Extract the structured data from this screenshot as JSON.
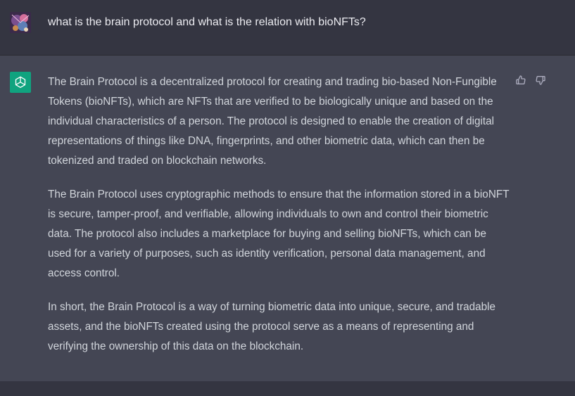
{
  "user_message": {
    "text": "what is the brain protocol and what is the relation with bioNFTs?",
    "avatar": "user-avatar-image"
  },
  "assistant_message": {
    "logo": "openai-logo-icon",
    "paragraphs": [
      "The Brain Protocol is a decentralized protocol for creating and trading bio-based Non-Fungible Tokens (bioNFTs), which are NFTs that are verified to be biologically unique and based on the individual characteristics of a person. The protocol is designed to enable the creation of digital representations of things like DNA, fingerprints, and other biometric data, which can then be tokenized and traded on blockchain networks.",
      "The Brain Protocol uses cryptographic methods to ensure that the information stored in a bioNFT is secure, tamper-proof, and verifiable, allowing individuals to own and control their biometric data. The protocol also includes a marketplace for buying and selling bioNFTs, which can be used for a variety of purposes, such as identity verification, personal data management, and access control.",
      "In short, the Brain Protocol is a way of turning biometric data into unique, secure, and tradable assets, and the bioNFTs created using the protocol serve as a means of representing and verifying the ownership of this data on the blockchain."
    ],
    "feedback_icons": [
      "thumbs-up-icon",
      "thumbs-down-icon"
    ]
  },
  "colors": {
    "user_bg": "#343541",
    "assistant_bg": "#444654",
    "logo_green": "#10a37f",
    "text": "#d1d5db"
  }
}
